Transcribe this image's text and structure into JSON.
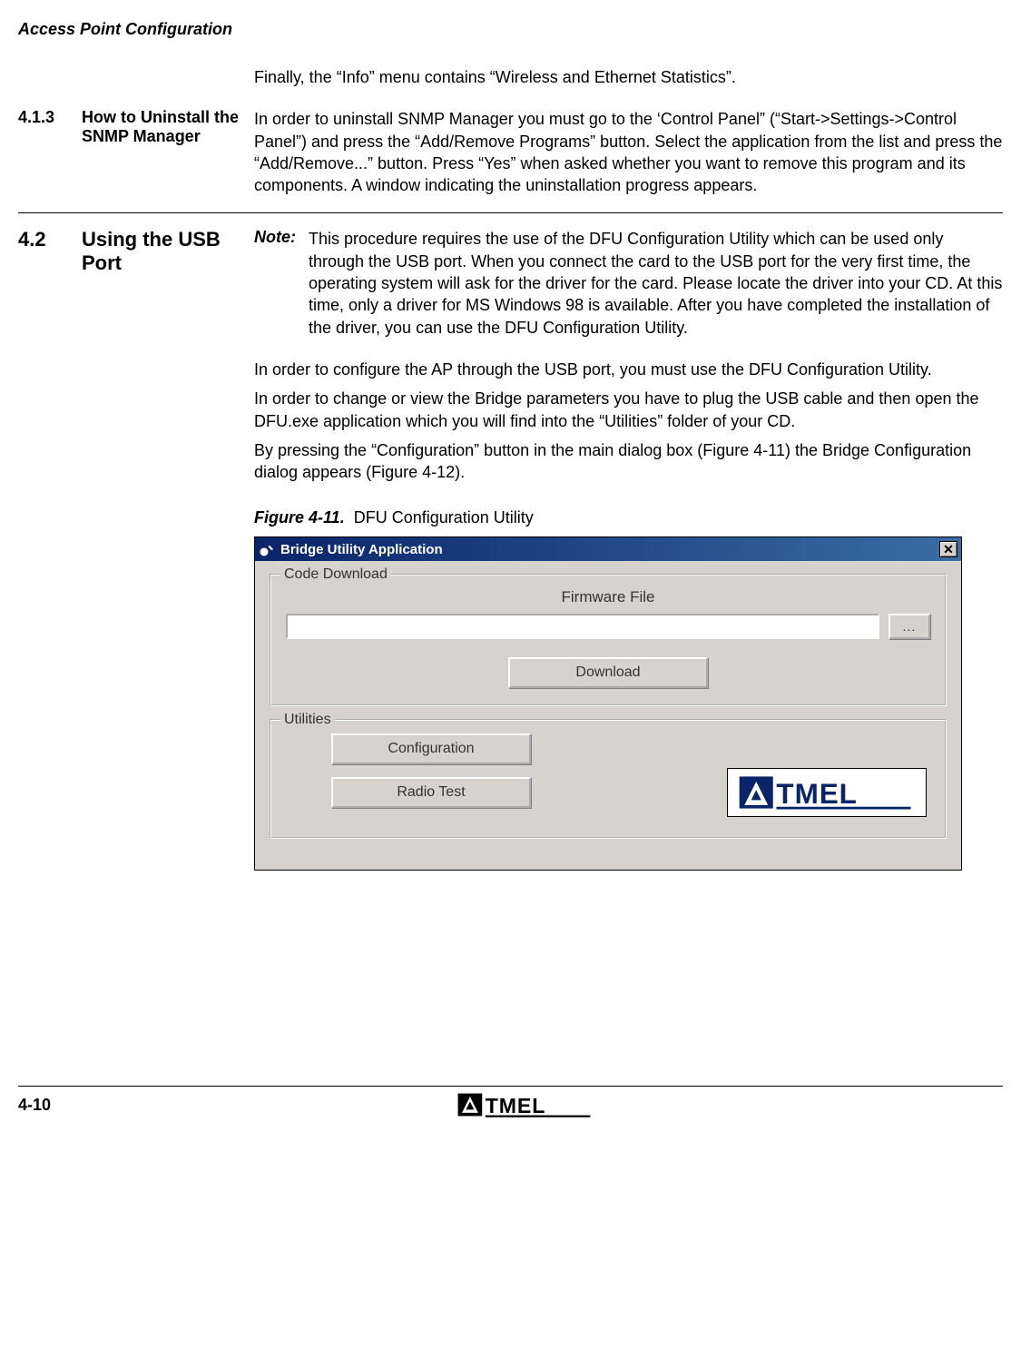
{
  "running_head": "Access Point Configuration",
  "intro_para": "Finally, the “Info” menu contains “Wireless and Ethernet Statistics”.",
  "sec413": {
    "num": "4.1.3",
    "title": "How to Uninstall the SNMP Manager",
    "body": "In order to uninstall SNMP Manager you must go to the ‘Control Panel” (“Start->Settings->Control Panel”) and press the “Add/Remove Programs” button. Select the application from the list and press the “Add/Remove...” button. Press “Yes” when asked whether you want to remove this program and its components. A window indicating the uninstallation progress appears."
  },
  "sec42": {
    "num": "4.2",
    "title": "Using the USB Port",
    "note_label": "Note:",
    "note_body": "This procedure requires the use of the DFU Configuration Utility which can be used only through the USB port. When you connect the card to the USB port for the very first time, the operating system will ask for the driver for the card. Please locate the driver into your CD. At this time, only a driver for MS Windows 98 is available. After you have completed the installation of the driver, you can use the DFU Configuration Utility.",
    "p1": "In order to configure the AP through the USB port, you must use the DFU Configuration Utility.",
    "p2": "In order to change or view the Bridge parameters you have to plug the USB cable and then open the DFU.exe application which you will find into the “Utilities” folder of your CD.",
    "p3": "By pressing the “Configuration” button in the main dialog box (Figure 4-11) the Bridge Configuration dialog appears (Figure 4-12)."
  },
  "figure": {
    "label": "Figure 4-11.",
    "caption": "DFU Configuration Utility"
  },
  "dialog": {
    "title": "Bridge Utility Application",
    "group1": {
      "legend": "Code Download",
      "field_label": "Firmware File",
      "browse": "...",
      "download": "Download"
    },
    "group2": {
      "legend": "Utilities",
      "config": "Configuration",
      "radio": "Radio Test"
    },
    "logo_text": "ATMEL"
  },
  "page_number": "4-10"
}
